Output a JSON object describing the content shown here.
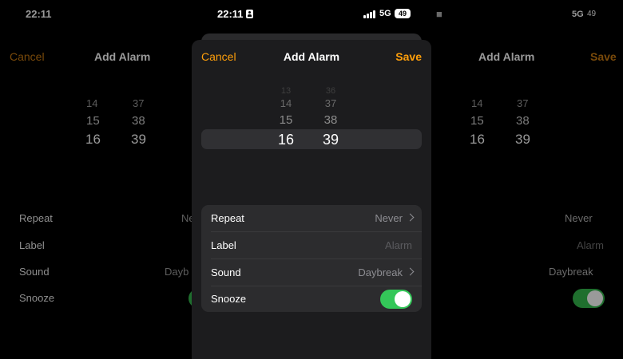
{
  "status": {
    "time": "22:11",
    "network": "5G",
    "battery": "49"
  },
  "nav": {
    "cancel": "Cancel",
    "title": "Add Alarm",
    "save": "Save"
  },
  "picker": {
    "hours": [
      "13",
      "14",
      "15",
      "16"
    ],
    "minutes": [
      "36",
      "37",
      "38",
      "39"
    ],
    "selected_hour": "16",
    "selected_minute": "39"
  },
  "options": [
    {
      "label": "Repeat",
      "value": "Never"
    },
    {
      "label": "Label",
      "placeholder": "Alarm"
    },
    {
      "label": "Sound",
      "value": "Daybreak"
    },
    {
      "label": "Snooze",
      "on": true
    }
  ],
  "colors": {
    "accent": "#ff9f0a",
    "toggle_on": "#34c759",
    "sheet": "#1c1c1e",
    "list": "#2c2c2e"
  }
}
